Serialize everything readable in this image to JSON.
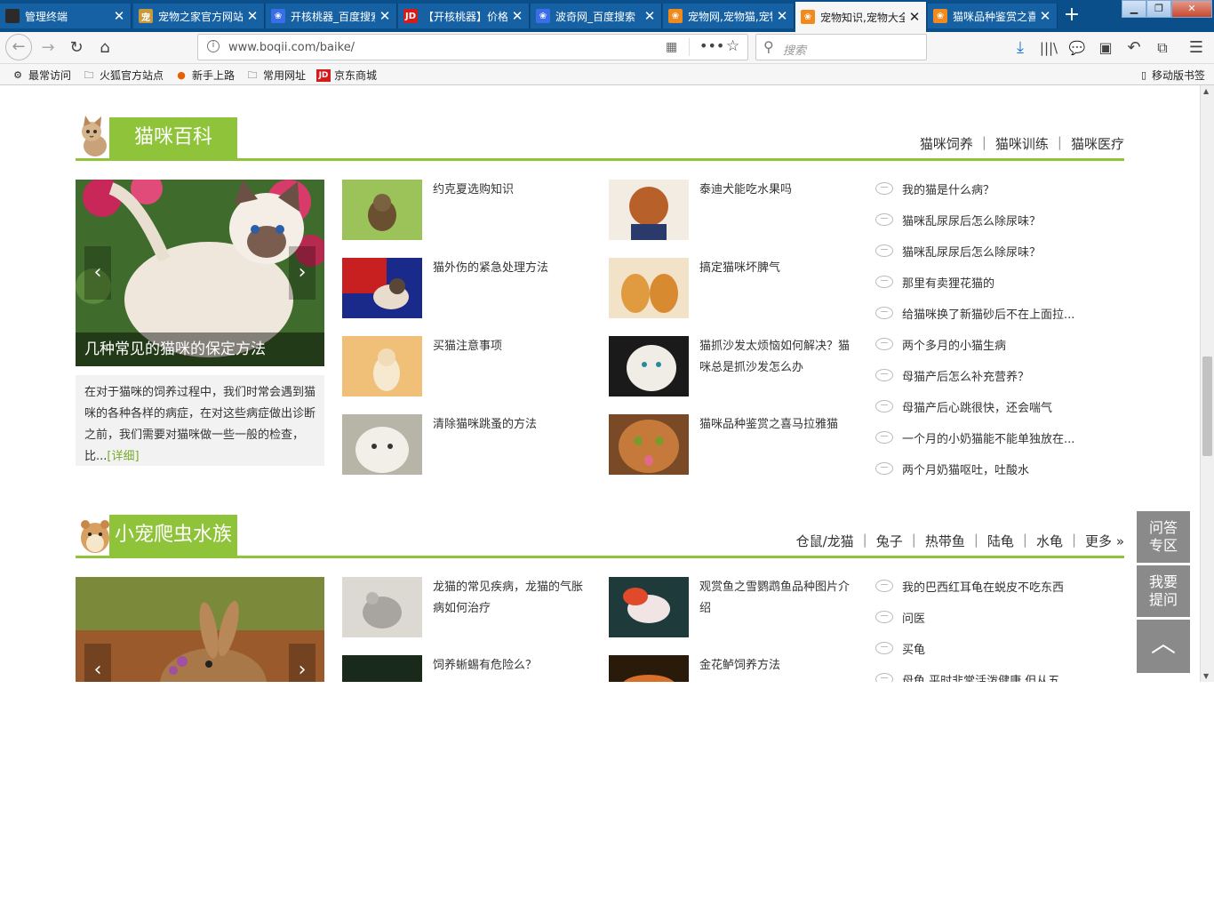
{
  "tabs": [
    {
      "title": "管理终端",
      "fav": "terminal-icon",
      "color": "#2b2b2b",
      "glyph": ""
    },
    {
      "title": "宠物之家官方网站",
      "fav": "pet-home-icon",
      "color": "#c79a3b",
      "glyph": "宠"
    },
    {
      "title": "开核桃器_百度搜索",
      "fav": "baidu-paw-icon",
      "color": "#3a6ee8",
      "glyph": "❀"
    },
    {
      "title": "【开核桃器】价格",
      "fav": "jd-icon",
      "color": "#d71a1a",
      "glyph": "JD"
    },
    {
      "title": "波奇网_百度搜索",
      "fav": "baidu-paw-icon",
      "color": "#3a6ee8",
      "glyph": "❀"
    },
    {
      "title": "宠物网,宠物猫,宠物",
      "fav": "boqii-paw-icon",
      "color": "#f08a1c",
      "glyph": "❀"
    },
    {
      "title": "宠物知识,宠物大全",
      "fav": "boqii-paw-icon",
      "color": "#f08a1c",
      "glyph": "❀",
      "active": true
    },
    {
      "title": "猫咪品种鉴赏之喜马拉雅",
      "fav": "boqii-paw-icon",
      "color": "#f08a1c",
      "glyph": "❀"
    }
  ],
  "url": "www.boqii.com/baike/",
  "search_placeholder": "搜索",
  "bookmarks": [
    "最常访问",
    "火狐官方站点",
    "新手上路",
    "常用网址",
    "京东商城"
  ],
  "mobile_bookmarks": "移动版书签",
  "sections": [
    {
      "title": "猫咪百科",
      "links": [
        "猫咪饲养",
        "猫咪训练",
        "猫咪医疗"
      ],
      "feature": {
        "caption": "几种常见的猫咪的保定方法",
        "summary": "在对于猫咪的饲养过程中，我们时常会遇到猫咪的各种各样的病症，在对这些病症做出诊断之前，我们需要对猫咪做一些一般的检查，比...",
        "more": "[详细]"
      },
      "col1": [
        "约克夏选购知识",
        "猫外伤的紧急处理方法",
        "买猫注意事项",
        "清除猫咪跳蚤的方法"
      ],
      "col2": [
        "泰迪犬能吃水果吗",
        "搞定猫咪坏脾气",
        "猫抓沙发太烦恼如何解决？猫咪总是抓沙发怎么办",
        "猫咪品种鉴赏之喜马拉雅猫"
      ],
      "qa": [
        "我的猫是什么病？",
        "猫咪乱尿尿后怎么除尿味？",
        "猫咪乱尿尿后怎么除尿味？",
        "那里有卖狸花猫的",
        "给猫咪换了新猫砂后不在上面拉...",
        "两个多月的小猫生病",
        "母猫产后怎么补充营养？",
        "母猫产后心跳很快，还会喘气",
        "一个月的小奶猫能不能单独放在...",
        "两个月奶猫呕吐，吐酸水"
      ]
    },
    {
      "title": "小宠爬虫水族",
      "links": [
        "仓鼠/龙猫",
        "兔子",
        "热带鱼",
        "陆龟",
        "水龟",
        "更多 »"
      ],
      "col1": [
        "龙猫的常见疾病，龙猫的气胀病如何治疗",
        "饲养蜥蜴有危险么？"
      ],
      "col2": [
        "观赏鱼之雪鹦鹉鱼品种图片介绍",
        "金花鲈饲养方法"
      ],
      "qa": [
        "我的巴西红耳龟在蜕皮不吃东西",
        "问医",
        "买龟",
        "母龟 平时非常活泼健康 但从五"
      ]
    }
  ],
  "side": {
    "qa_zone": "问答专区",
    "ask": "我要提问",
    "top": "︿"
  },
  "theme": {
    "green": "#8fc43a",
    "tabbar": "#0b4f8a"
  }
}
